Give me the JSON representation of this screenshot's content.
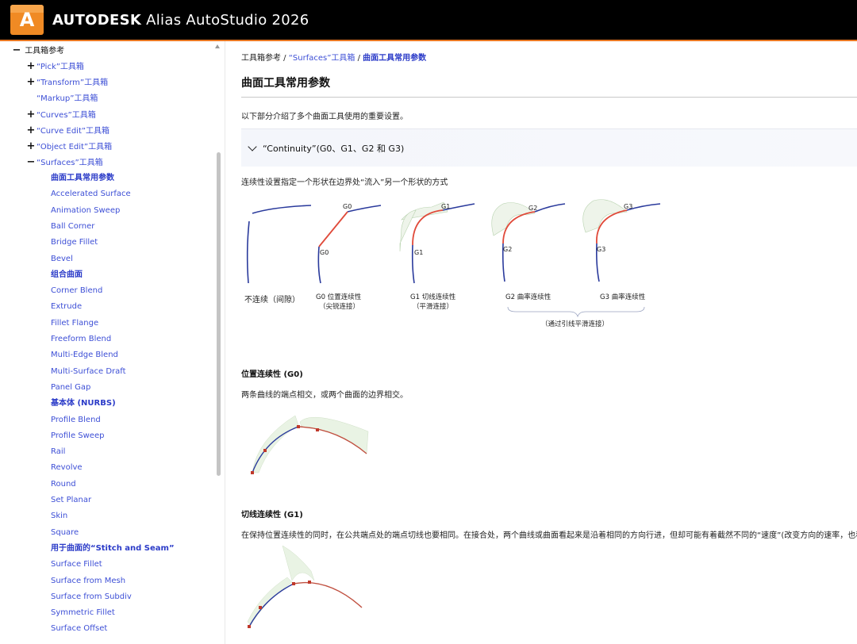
{
  "header": {
    "logo_letter": "A",
    "brand_bold": "AUTODESK",
    "brand_rest": " Alias AutoStudio 2026",
    "accent": "#e87722"
  },
  "sidebar": {
    "root_label": "工具箱参考",
    "items": [
      {
        "toggle": "+",
        "label": "“Pick”工具箱"
      },
      {
        "toggle": "+",
        "label": "“Transform”工具箱"
      },
      {
        "toggle": "",
        "label": "“Markup”工具箱"
      },
      {
        "toggle": "+",
        "label": "“Curves”工具箱"
      },
      {
        "toggle": "+",
        "label": "“Curve Edit”工具箱"
      },
      {
        "toggle": "+",
        "label": "“Object Edit”工具箱"
      },
      {
        "toggle": "−",
        "label": "“Surfaces”工具箱"
      }
    ],
    "sub_items": [
      "曲面工具常用参数",
      "Accelerated Surface",
      "Animation Sweep",
      "Ball Corner",
      "Bridge Fillet",
      "Bevel",
      "组合曲面",
      "Corner Blend",
      "Extrude",
      "Fillet Flange",
      "Freeform Blend",
      "Multi-Edge Blend",
      "Multi-Surface Draft",
      "Panel Gap",
      "基本体 (NURBS)",
      "Profile Blend",
      "Profile Sweep",
      "Rail",
      "Revolve",
      "Round",
      "Set Planar",
      "Skin",
      "Square",
      "用于曲面的“Stitch and Seam”",
      "Surface Fillet",
      "Surface from Mesh",
      "Surface from Subdiv",
      "Symmetric Fillet",
      "Surface Offset"
    ]
  },
  "content": {
    "breadcrumb": {
      "root": "工具箱参考",
      "sep": " / ",
      "parent": "“Surfaces”工具箱",
      "current": "曲面工具常用参数"
    },
    "title": "曲面工具常用参数",
    "intro": "以下部分介绍了多个曲面工具使用的重要设置。",
    "accordion_label": "“Continuity”(G0、G1、G2 和 G3)",
    "continuity_desc": "连续性设置指定一个形状在边界处“流入”另一个形状的方式",
    "diagram": {
      "labels": [
        "G0",
        "G0",
        "G1",
        "G1",
        "G2",
        "G2",
        "G3",
        "G3"
      ],
      "captions": [
        "不连续（间隙）",
        "G0 位置连续性",
        "（尖锐连接）",
        "G1 切线连续性",
        "（平滑连接）",
        "G2 曲率连续性",
        "G3 曲率连续性",
        "（通过引线平滑连接）"
      ]
    },
    "g0_heading": "位置连续性 (G0)",
    "g0_desc": "两条曲线的端点相交，或两个曲面的边界相交。",
    "g1_heading": "切线连续性 (G1)",
    "g1_desc": "在保持位置连续性的同时，在公共端点处的端点切线也要相同。在接合处，两个曲线或曲面看起来是沿着相同的方向行进，但却可能有着截然不同的“速度”(改变方向的速率，也称为"
  },
  "colors": {
    "link": "#3d4fd6",
    "curve_blue": "#2a3a9c",
    "curve_red": "#e04a3a",
    "comb_green": "#8fbf8f"
  }
}
